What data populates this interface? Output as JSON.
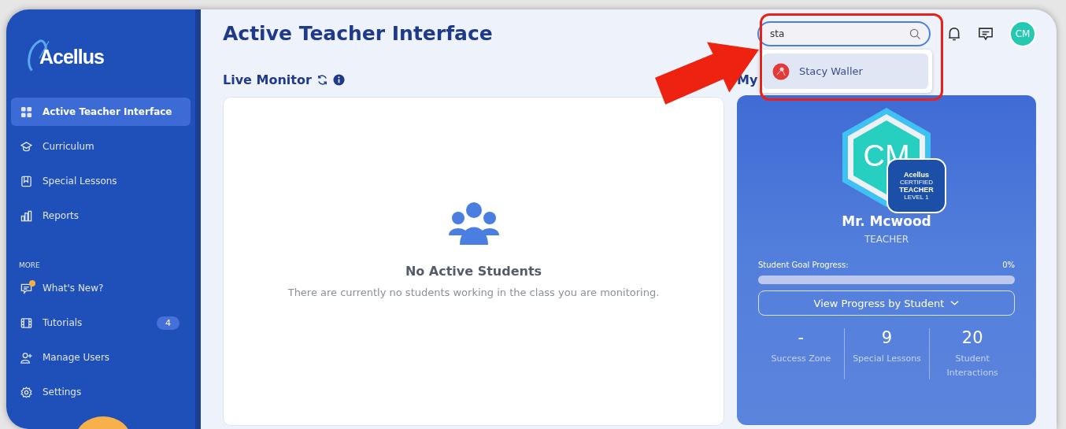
{
  "sidebar": {
    "logo": "Acellus",
    "items": [
      {
        "label": "Active Teacher Interface",
        "selected": true
      },
      {
        "label": "Curriculum",
        "selected": false
      },
      {
        "label": "Special Lessons",
        "selected": false
      },
      {
        "label": "Reports",
        "selected": false
      }
    ],
    "section_label": "MORE",
    "more_items": [
      {
        "label": "What's New?",
        "notification": true
      },
      {
        "label": "Tutorials",
        "badge": "4",
        "notification": false
      },
      {
        "label": "Manage Users",
        "notification": false
      },
      {
        "label": "Settings",
        "notification": false
      }
    ]
  },
  "header": {
    "title": "Active Teacher Interface",
    "search": {
      "value": "sta",
      "results": [
        {
          "name": "Stacy Waller",
          "selected": true
        }
      ]
    },
    "avatar": "CM"
  },
  "live_monitor": {
    "title": "Live Monitor",
    "empty_title": "No Active Students",
    "empty_text": "There are currently no students working in the class you are monitoring."
  },
  "profile": {
    "heading": "My",
    "initials": "CM",
    "badge": {
      "brand": "Acellus",
      "line": "CERTIFIED",
      "role": "TEACHER",
      "level": "LEVEL 1"
    },
    "name": "Mr. Mcwood",
    "role": "TEACHER",
    "goal": {
      "label": "Student Goal Progress:",
      "reading": "0%",
      "level": 0
    },
    "button": "View Progress by Student",
    "stats": [
      {
        "value": "-",
        "label": "Success Zone"
      },
      {
        "value": "9",
        "label": "Special Lessons"
      },
      {
        "value": "20",
        "label": "Student Interactions"
      }
    ]
  }
}
